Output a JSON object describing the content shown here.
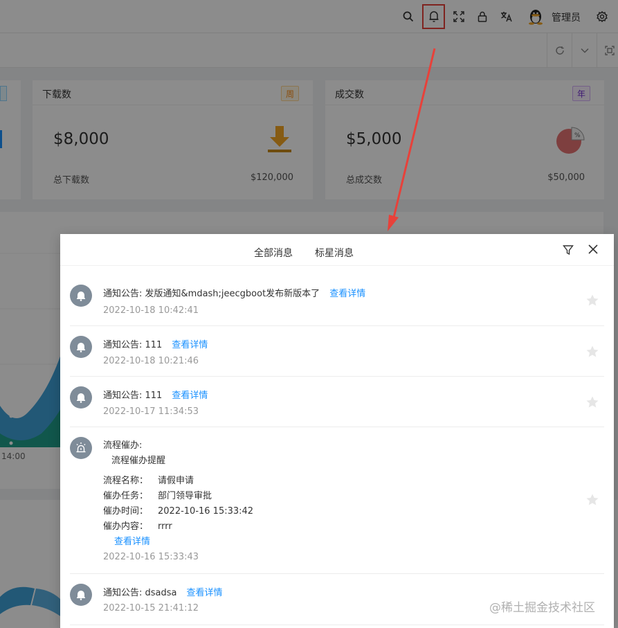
{
  "header": {
    "user_name": "管理员",
    "icons": [
      "search-icon",
      "bell-icon",
      "fullscreen-icon",
      "lock-icon",
      "translate-icon",
      "avatar",
      "gear-icon"
    ]
  },
  "tabbar": {
    "icons": [
      "refresh-icon",
      "chevron-down-icon",
      "fold-icon"
    ]
  },
  "cards": [
    {
      "title": "下载数",
      "tag": "周",
      "tag_color": "#fa8c16",
      "value": "$8,000",
      "label": "总下载数",
      "total": "$120,000"
    },
    {
      "title": "成交数",
      "tag": "年",
      "tag_color": "#722ed1",
      "value": "$5,000",
      "label": "总成交数",
      "total": "$50,000"
    }
  ],
  "chart": {
    "axis_label": "14:00"
  },
  "notification": {
    "tabs": [
      "全部消息",
      "标星消息"
    ],
    "link_label": "查看详情",
    "messages": [
      {
        "title": "通知公告: 发版通知&mdash;jeecgboot发布新版本了",
        "time": "2022-10-18 10:42:41"
      },
      {
        "title": "通知公告: 111",
        "time": "2022-10-18 10:21:46"
      },
      {
        "title": "通知公告: 111",
        "time": "2022-10-17 11:34:53"
      },
      {
        "title": "流程催办:",
        "subtitle": "流程催办提醒",
        "fields": [
          {
            "key": "流程名称：",
            "value": "请假申请"
          },
          {
            "key": "催办任务：",
            "value": "部门领导审批"
          },
          {
            "key": "催办时间：",
            "value": "2022-10-16 15:33:42"
          },
          {
            "key": "催办内容：",
            "value": "rrrr"
          }
        ],
        "time": "2022-10-16 15:33:43"
      },
      {
        "title": "通知公告: dsadsa",
        "time": "2022-10-15 21:41:12"
      }
    ]
  },
  "watermark": "@稀土掘金技术社区",
  "colors": {
    "accent": "#1890ff",
    "highlight": "#e8413a",
    "avatar_bg": "#7f8c99"
  }
}
